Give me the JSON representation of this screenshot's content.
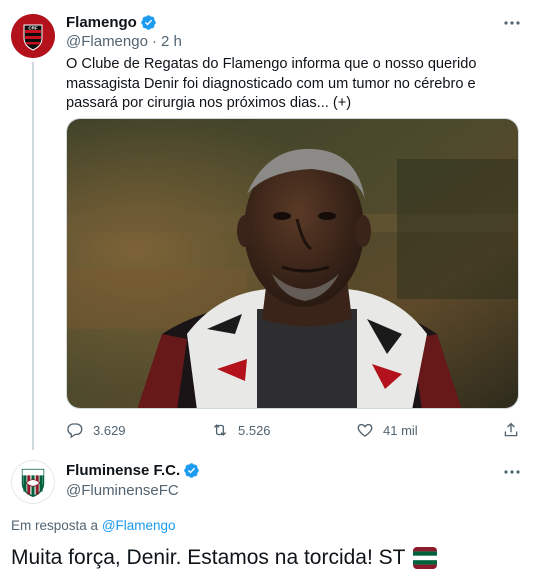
{
  "tweet": {
    "author_name": "Flamengo",
    "handle": "@Flamengo",
    "separator": "·",
    "time": "2 h",
    "text": "O Clube de Regatas do Flamengo informa que o nosso querido massagista Denir foi diagnosticado com um tumor no cérebro e passará por cirurgia nos próximos dias...",
    "show_more": "(+)",
    "stats": {
      "replies": "3.629",
      "retweets": "5.526",
      "likes": "41 mil"
    }
  },
  "reply": {
    "author_name": "Fluminense F.C.",
    "handle": "@FluminenseFC",
    "reply_prefix": "Em resposta a",
    "reply_to": "@Flamengo",
    "text": "Muita força, Denir. Estamos na torcida! ST"
  },
  "icons": {
    "verified": "verified-badge-icon",
    "more": "more-horizontal-icon",
    "reply": "reply-icon",
    "retweet": "retweet-icon",
    "like": "heart-icon",
    "share": "share-icon",
    "flag": "fluminense-flag-emoji"
  },
  "colors": {
    "text_primary": "#0f1419",
    "text_secondary": "#536471",
    "link_blue": "#1d9bf0",
    "verified_blue": "#1d9bf0",
    "divider": "#cfd9de",
    "flamengo_red": "#b3121c",
    "fluminense_green": "#00613c",
    "fluminense_grena": "#8b1a2b"
  }
}
